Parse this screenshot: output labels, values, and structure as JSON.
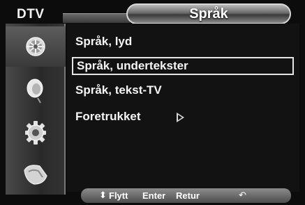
{
  "header": {
    "mode_label": "DTV",
    "title": "Språk"
  },
  "sidebar": {
    "items": [
      {
        "name": "picture",
        "icon": "satellite-dish-icon"
      },
      {
        "name": "sound",
        "icon": "speaker-icon"
      },
      {
        "name": "setup",
        "icon": "gear-icon"
      },
      {
        "name": "input",
        "icon": "plug-icon"
      }
    ],
    "active_index": 0
  },
  "menu": {
    "items": [
      {
        "label": "Språk, lyd"
      },
      {
        "label": "Språk, undertekster"
      },
      {
        "label": "Språk, tekst-TV"
      },
      {
        "label": "Foretrukket"
      }
    ],
    "selected_index": 1
  },
  "footer": {
    "move_glyph": "⬍",
    "move_label": "Flytt",
    "enter_label": "Enter",
    "return_label": "Retur",
    "return_glyph": "↶"
  },
  "colors": {
    "panel_bg": "#121212",
    "text": "#f5f5f5",
    "selection_border": "#e6e6e6"
  }
}
